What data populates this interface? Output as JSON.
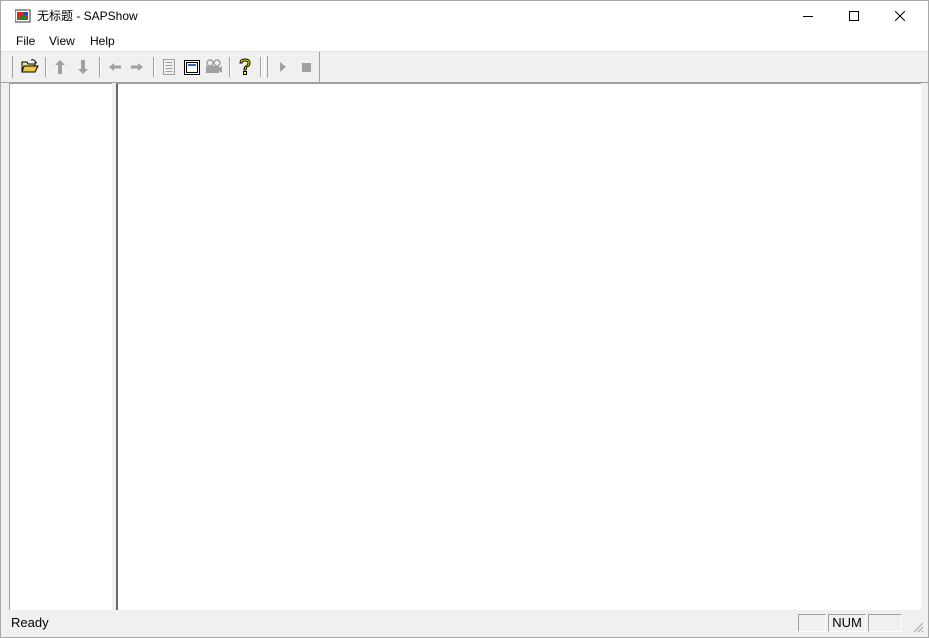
{
  "window": {
    "title": "无标题 - SAPShow"
  },
  "menu": {
    "items": [
      "File",
      "View",
      "Help"
    ]
  },
  "toolbar": {
    "buttons": [
      {
        "icon": "open-folder-icon",
        "enabled": true
      },
      {
        "icon": "arrow-up-icon",
        "enabled": false
      },
      {
        "icon": "arrow-down-icon",
        "enabled": false
      },
      {
        "icon": "arrow-left-icon",
        "enabled": false
      },
      {
        "icon": "arrow-right-icon",
        "enabled": false
      },
      {
        "icon": "document-icon",
        "enabled": false
      },
      {
        "icon": "picture-frame-icon",
        "enabled": true
      },
      {
        "icon": "video-camera-icon",
        "enabled": false
      },
      {
        "icon": "help-icon",
        "enabled": true
      },
      {
        "icon": "play-icon",
        "enabled": false
      },
      {
        "icon": "stop-icon",
        "enabled": false
      }
    ]
  },
  "statusbar": {
    "text": "Ready",
    "indicators": [
      "",
      "NUM",
      ""
    ]
  },
  "colors": {
    "chrome": "#f0f0f0",
    "pane": "#ffffff",
    "disabled": "#a0a0a0",
    "help_yellow": "#ffff00"
  }
}
